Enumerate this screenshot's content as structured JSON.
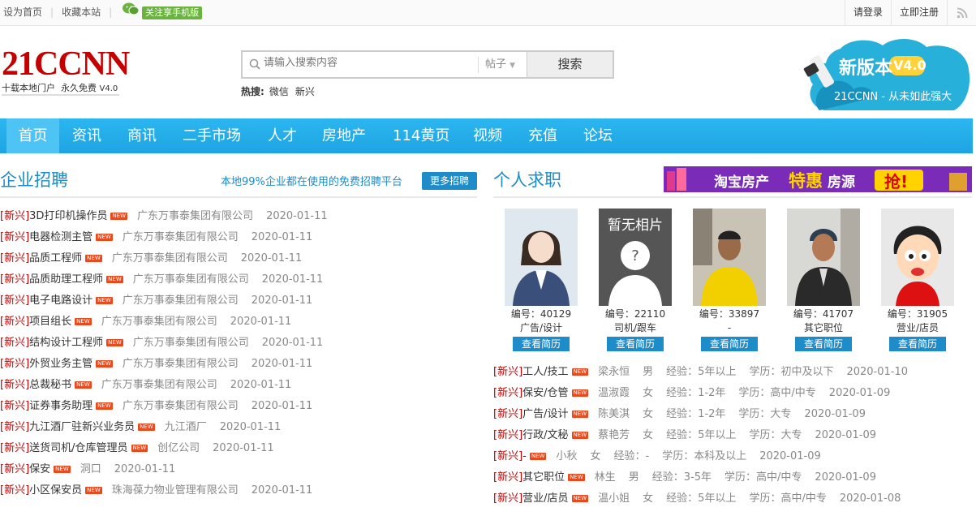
{
  "topbar": {
    "home": "设为首页",
    "fav": "收藏本站",
    "wechat": "关注享手机版",
    "login": "请登录",
    "register": "立即注册"
  },
  "logo": {
    "name": "21CCNN",
    "slogan": "十载本地门户  永久免费",
    "ver": "V4.0"
  },
  "search": {
    "placeholder": "请输入搜索内容",
    "type": "帖子",
    "button": "搜索"
  },
  "hot": {
    "label": "热搜:",
    "items": [
      "微信",
      "新兴"
    ]
  },
  "banner": {
    "line1": "新版本",
    "ver": "V4.0",
    "line2": "21CCNN - 从未如此强大"
  },
  "nav": [
    "首页",
    "资讯",
    "商讯",
    "二手市场",
    "人才",
    "房地产",
    "114黄页",
    "视频",
    "充值",
    "论坛"
  ],
  "jobs": {
    "title": "企业招聘",
    "slogan": "本地99%企业都在使用的免费招聘平台",
    "more": "更多招聘",
    "new_badge": "NEW",
    "rows": [
      {
        "tag": "[新兴]",
        "title": "3D打印机操作员",
        "company": "广东万事泰集团有限公司",
        "date": "2020-01-11"
      },
      {
        "tag": "[新兴]",
        "title": "电器检测主管",
        "company": "广东万事泰集团有限公司",
        "date": "2020-01-11"
      },
      {
        "tag": "[新兴]",
        "title": "品质工程师",
        "company": "广东万事泰集团有限公司",
        "date": "2020-01-11"
      },
      {
        "tag": "[新兴]",
        "title": "品质助理工程师",
        "company": "广东万事泰集团有限公司",
        "date": "2020-01-11"
      },
      {
        "tag": "[新兴]",
        "title": "电子电路设计",
        "company": "广东万事泰集团有限公司",
        "date": "2020-01-11"
      },
      {
        "tag": "[新兴]",
        "title": "项目组长",
        "company": "广东万事泰集团有限公司",
        "date": "2020-01-11"
      },
      {
        "tag": "[新兴]",
        "title": "结构设计工程师",
        "company": "广东万事泰集团有限公司",
        "date": "2020-01-11"
      },
      {
        "tag": "[新兴]",
        "title": "外贸业务主管",
        "company": "广东万事泰集团有限公司",
        "date": "2020-01-11"
      },
      {
        "tag": "[新兴]",
        "title": "总裁秘书",
        "company": "广东万事泰集团有限公司",
        "date": "2020-01-11"
      },
      {
        "tag": "[新兴]",
        "title": "证券事务助理",
        "company": "广东万事泰集团有限公司",
        "date": "2020-01-11"
      },
      {
        "tag": "[新兴]",
        "title": "九江酒厂驻新兴业务员",
        "company": "九江酒厂",
        "date": "2020-01-11"
      },
      {
        "tag": "[新兴]",
        "title": "送货司机/仓库管理员",
        "company": "创亿公司",
        "date": "2020-01-11"
      },
      {
        "tag": "[新兴]",
        "title": "保安",
        "company": "洞口",
        "date": "2020-01-11"
      },
      {
        "tag": "[新兴]",
        "title": "小区保安员",
        "company": "珠海葆力物业管理有限公司",
        "date": "2020-01-11"
      }
    ]
  },
  "resumes": {
    "title": "个人求职",
    "ad": {
      "text1": "淘宝房产",
      "text2": "特惠",
      "text3": "房源",
      "text4": "抢!"
    },
    "cards": [
      {
        "no": "编号：40129",
        "job": "广告/设计",
        "btn": "查看简历"
      },
      {
        "no": "编号：22110",
        "job": "司机/跟车",
        "btn": "查看简历",
        "placeholder": "暂无相片"
      },
      {
        "no": "编号：33897",
        "job": "-",
        "btn": "查看简历"
      },
      {
        "no": "编号：41707",
        "job": "其它职位",
        "btn": "查看简历"
      },
      {
        "no": "编号：31905",
        "job": "营业/店员",
        "btn": "查看简历"
      }
    ],
    "rows": [
      {
        "tag": "[新兴]",
        "title": "工人/技工",
        "name": "梁永恒",
        "sex": "男",
        "exp": "经验：5年以上",
        "edu": "学历：初中及以下",
        "date": "2020-01-10"
      },
      {
        "tag": "[新兴]",
        "title": "保安/仓管",
        "name": "温淑霞",
        "sex": "女",
        "exp": "经验：1-2年",
        "edu": "学历：高中/中专",
        "date": "2020-01-09"
      },
      {
        "tag": "[新兴]",
        "title": "广告/设计",
        "name": "陈美淇",
        "sex": "女",
        "exp": "经验：1-2年",
        "edu": "学历：大专",
        "date": "2020-01-09"
      },
      {
        "tag": "[新兴]",
        "title": "行政/文秘",
        "name": "蔡艳芳",
        "sex": "女",
        "exp": "经验：5年以上",
        "edu": "学历：大专",
        "date": "2020-01-09"
      },
      {
        "tag": "[新兴]",
        "title": "-",
        "name": "小秋",
        "sex": "女",
        "exp": "经验：-",
        "edu": "学历：本科及以上",
        "date": "2020-01-09"
      },
      {
        "tag": "[新兴]",
        "title": "其它职位",
        "name": "林生",
        "sex": "男",
        "exp": "经验：3-5年",
        "edu": "学历：高中/中专",
        "date": "2020-01-09"
      },
      {
        "tag": "[新兴]",
        "title": "营业/店员",
        "name": "温小姐",
        "sex": "女",
        "exp": "经验：5年以上",
        "edu": "学历：高中/中专",
        "date": "2020-01-08"
      }
    ]
  }
}
